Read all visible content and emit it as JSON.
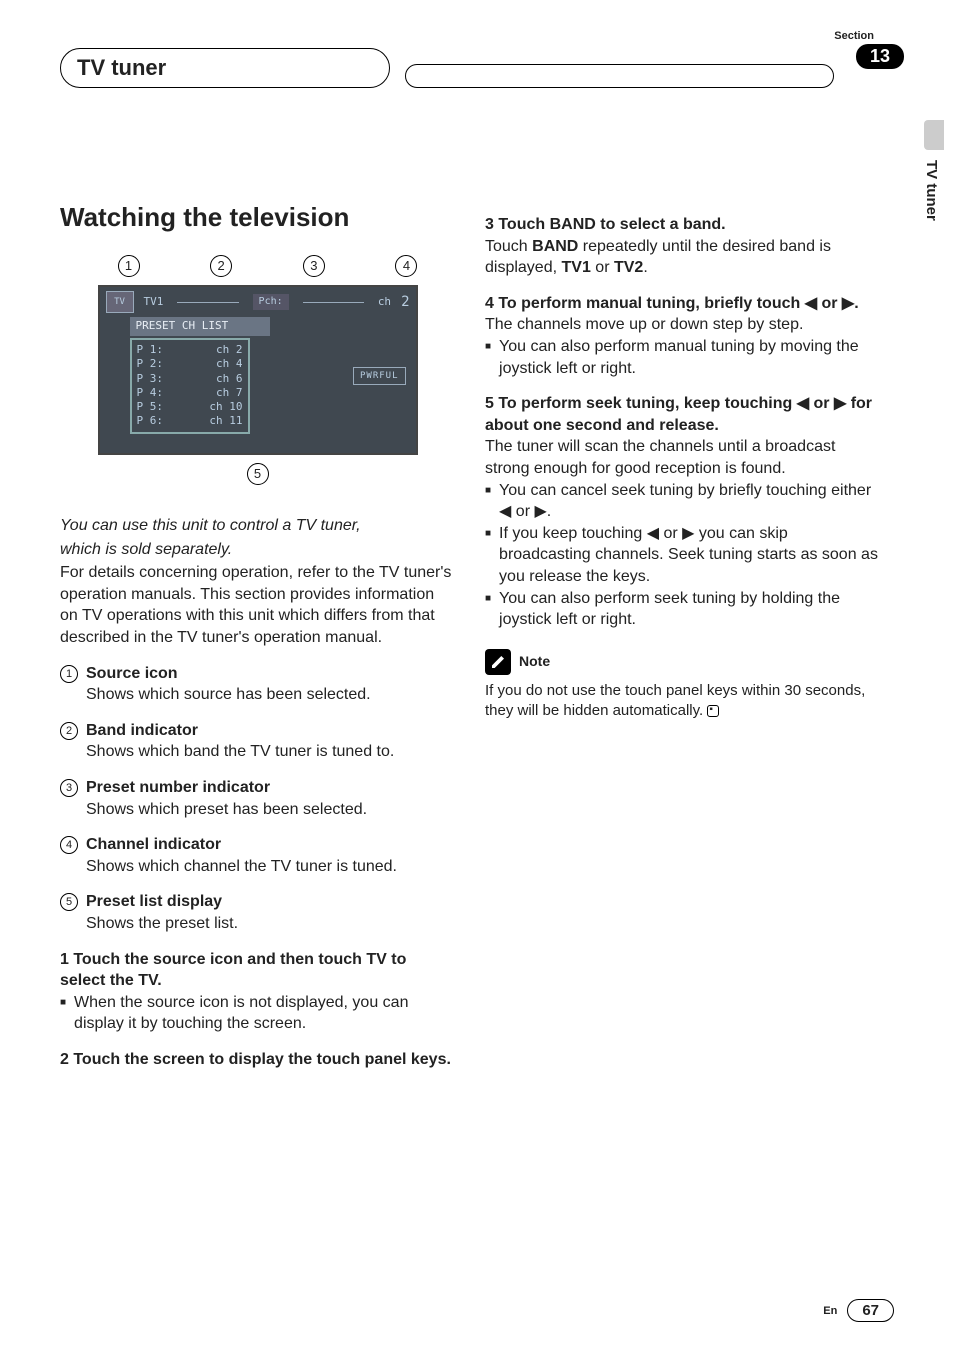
{
  "header": {
    "title": "TV tuner",
    "section_label": "Section",
    "section_number": "13"
  },
  "side": {
    "vertical": "TV tuner"
  },
  "h1": "Watching the television",
  "diagram": {
    "top_callouts": [
      "1",
      "2",
      "3",
      "4"
    ],
    "bottom_callout": "5",
    "band": "TV1",
    "pch_label": "Pch:",
    "ch_label": "ch",
    "ch_value": "2",
    "preset_header": "PRESET CH LIST",
    "presets": [
      {
        "p": "P 1:",
        "c": "ch  2"
      },
      {
        "p": "P 2:",
        "c": "ch  4"
      },
      {
        "p": "P 3:",
        "c": "ch  6"
      },
      {
        "p": "P 4:",
        "c": "ch  7"
      },
      {
        "p": "P 5:",
        "c": "ch 10"
      },
      {
        "p": "P 6:",
        "c": "ch 11"
      }
    ],
    "pwrful": "PWRFUL"
  },
  "intro": {
    "italic1": "You can use this unit to control a TV tuner,",
    "italic2": "which is sold separately.",
    "para": "For details concerning operation, refer to the TV tuner's operation manuals. This section provides information on TV operations with this unit which differs from that described in the TV tuner's operation manual."
  },
  "legend": [
    {
      "n": "1",
      "t": "Source icon",
      "d": "Shows which source has been selected."
    },
    {
      "n": "2",
      "t": "Band indicator",
      "d": "Shows which band the TV tuner is tuned to."
    },
    {
      "n": "3",
      "t": "Preset number indicator",
      "d": "Shows which preset has been selected."
    },
    {
      "n": "4",
      "t": "Channel indicator",
      "d": "Shows which channel the TV tuner is tuned."
    },
    {
      "n": "5",
      "t": "Preset list display",
      "d": "Shows the preset list."
    }
  ],
  "steps_left": [
    {
      "head": "1    Touch the source icon and then touch TV to select the TV.",
      "body": "",
      "bullets": [
        "When the source icon is not displayed, you can display it by touching the screen."
      ]
    },
    {
      "head": "2    Touch the screen to display the touch panel keys.",
      "body": "",
      "bullets": []
    }
  ],
  "steps_right": [
    {
      "head": "3    Touch BAND to select a band.",
      "body_parts": [
        "Touch ",
        "BAND",
        " repeatedly until the desired band is displayed, ",
        "TV1",
        " or ",
        "TV2",
        "."
      ],
      "bullets": []
    },
    {
      "head": "4    To perform manual tuning, briefly touch ◀ or ▶.",
      "body": "The channels move up or down step by step.",
      "bullets": [
        "You can also perform manual tuning by moving the joystick left or right."
      ]
    },
    {
      "head": "5    To perform seek tuning, keep touching ◀ or ▶ for about one second and release.",
      "body": "The tuner will scan the channels until a broadcast strong enough for good reception is found.",
      "bullets": [
        "You can cancel seek tuning by briefly touching either ◀ or ▶.",
        "If you keep touching ◀ or ▶ you can skip broadcasting channels. Seek tuning starts as soon as you release the keys.",
        "You can also perform seek tuning by holding the joystick left or right."
      ]
    }
  ],
  "note": {
    "label": "Note",
    "text": "If you do not use the touch panel keys within 30 seconds, they will be hidden automatically."
  },
  "footer": {
    "lang": "En",
    "page": "67"
  }
}
